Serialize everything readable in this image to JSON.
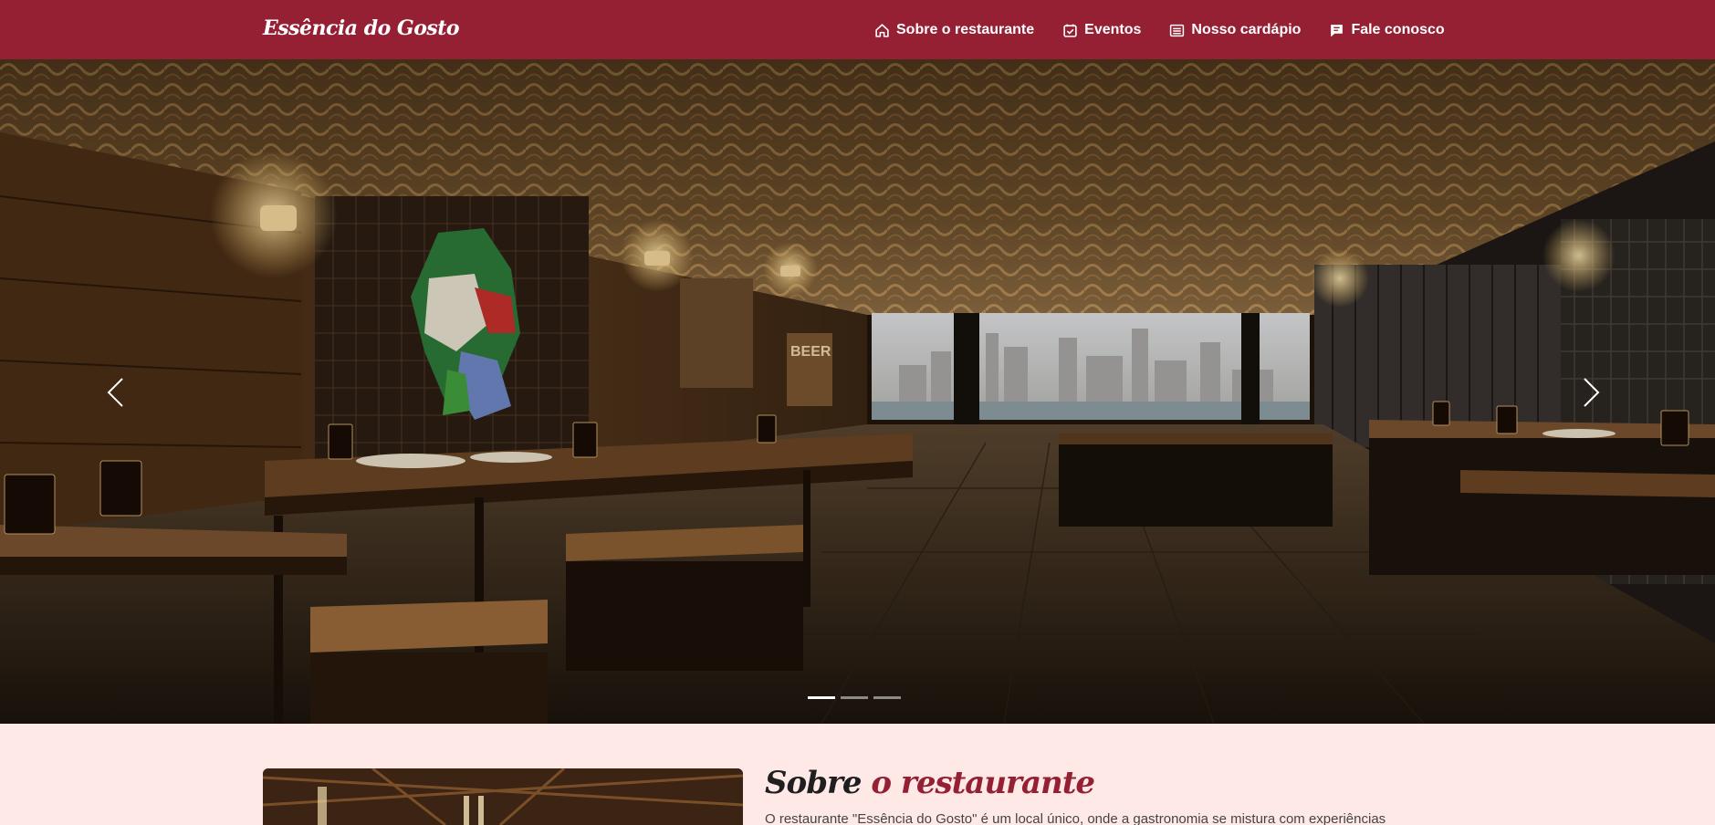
{
  "brand": "Essência do Gosto",
  "nav": [
    {
      "label": "Sobre o restaurante",
      "icon": "home-icon"
    },
    {
      "label": "Eventos",
      "icon": "calendar-check-icon"
    },
    {
      "label": "Nosso cardápio",
      "icon": "menu-list-icon"
    },
    {
      "label": "Fale conosco",
      "icon": "chat-icon"
    }
  ],
  "carousel": {
    "prev_icon": "chevron-left-icon",
    "next_icon": "chevron-right-icon",
    "slides": 3,
    "active_slide": 1,
    "image_signs": {
      "beer": "BEER"
    }
  },
  "about": {
    "title_plain": "Sobre",
    "title_accent": " o restaurante",
    "text": "O restaurante \"Essência do Gosto\" é um local único, onde a gastronomia se mistura com experiências"
  },
  "colors": {
    "brand": "#951f33",
    "background": "#ffe9e7"
  }
}
